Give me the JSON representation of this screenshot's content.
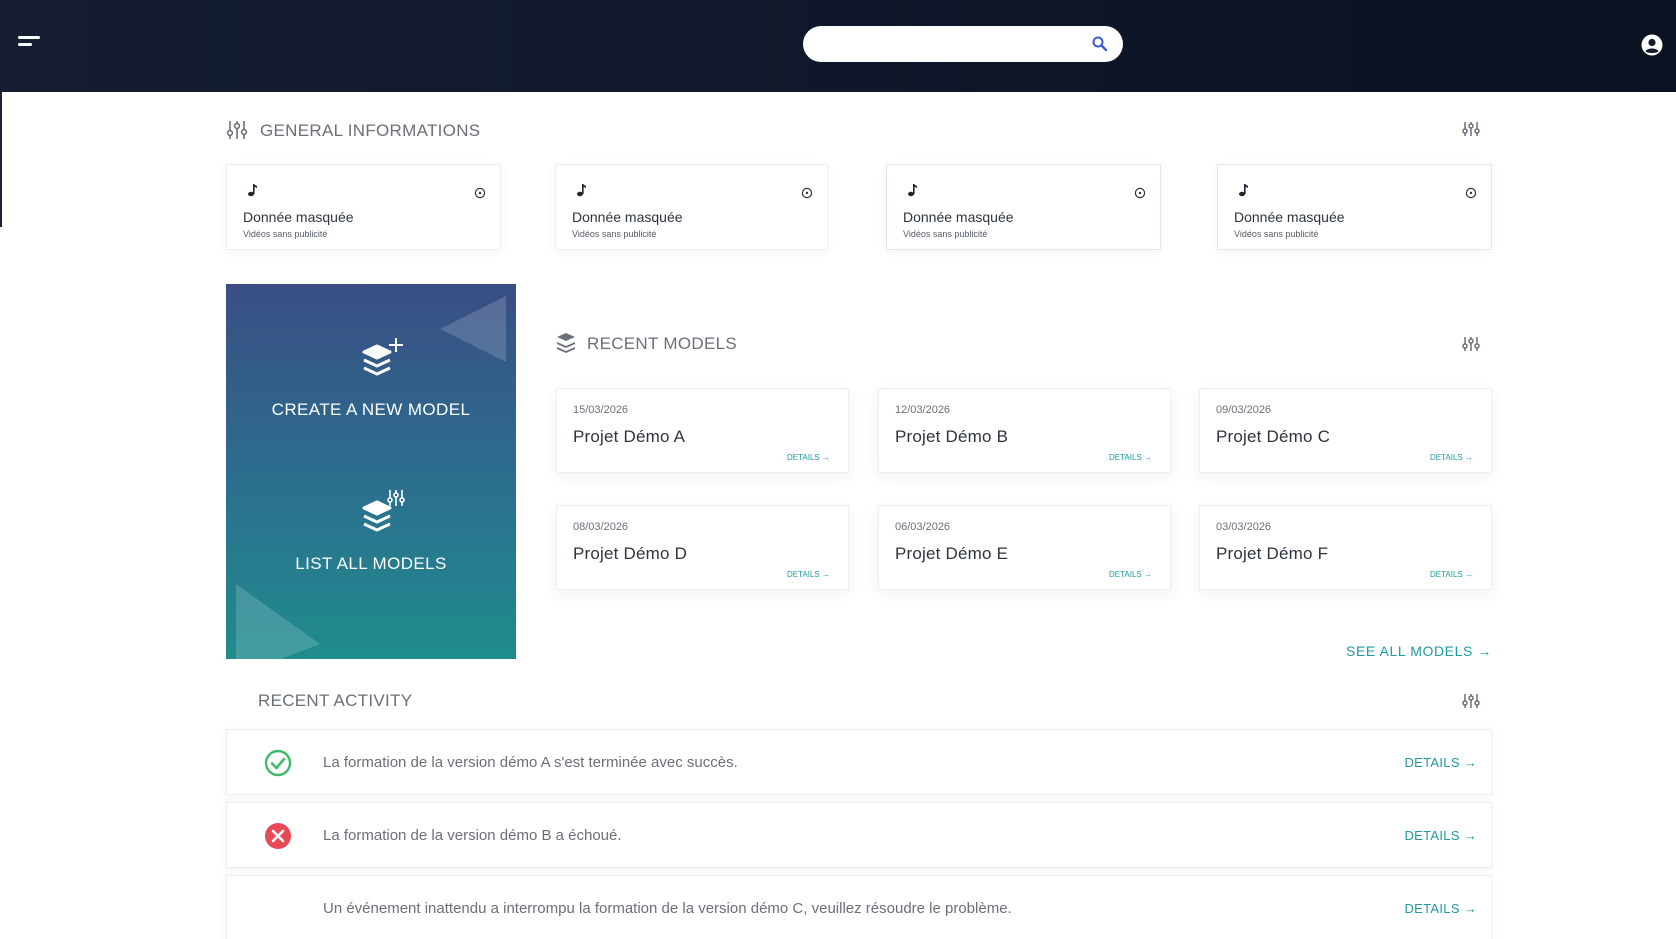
{
  "header": {
    "search": {
      "placeholder": "",
      "value": ""
    }
  },
  "general": {
    "title": "GENERAL INFORMATIONS",
    "cards": [
      {
        "title": "Donnée masquée",
        "subtitle": "Vidéos sans publicité"
      },
      {
        "title": "Donnée masquée",
        "subtitle": "Vidéos sans publicité"
      },
      {
        "title": "Donnée masquée",
        "subtitle": "Vidéos sans publicité"
      },
      {
        "title": "Donnée masquée",
        "subtitle": "Vidéos sans publicité"
      }
    ]
  },
  "panel": {
    "create_label": "CREATE A NEW MODEL",
    "list_label": "LIST ALL MODELS"
  },
  "recent_models": {
    "title": "RECENT MODELS",
    "details_label": "DETAILS →",
    "see_all_label": "SEE ALL MODELS →",
    "items": [
      {
        "date": "15/03/2026",
        "name": "Projet Démo A"
      },
      {
        "date": "12/03/2026",
        "name": "Projet Démo B"
      },
      {
        "date": "09/03/2026",
        "name": "Projet Démo C"
      },
      {
        "date": "08/03/2026",
        "name": "Projet Démo D"
      },
      {
        "date": "06/03/2026",
        "name": "Projet Démo E"
      },
      {
        "date": "03/03/2026",
        "name": "Projet Démo F"
      }
    ]
  },
  "activity": {
    "title": "RECENT ACTIVITY",
    "details_label": "DETAILS →",
    "items": [
      {
        "status": "success",
        "message": "La formation de la version démo A s'est terminée avec succès."
      },
      {
        "status": "error",
        "message": "La formation de la version démo B a échoué."
      },
      {
        "status": "none",
        "message": "Un événement inattendu a interrompu la formation de la version démo C, veuillez résoudre le problème."
      }
    ]
  },
  "colors": {
    "topbar": "#121a2e",
    "accent": "#1f9aa0",
    "success": "#3dbb6a",
    "error": "#e84a55",
    "panel_top": "#3a4e84",
    "panel_bottom": "#1f8c8d"
  },
  "icons": {
    "menu": "menu-icon",
    "search": "search-icon",
    "user": "user-circle-icon",
    "filter": "sliders-icon",
    "layers": "layers-icon",
    "note": "music-note-icon",
    "info": "info-circle-icon"
  }
}
